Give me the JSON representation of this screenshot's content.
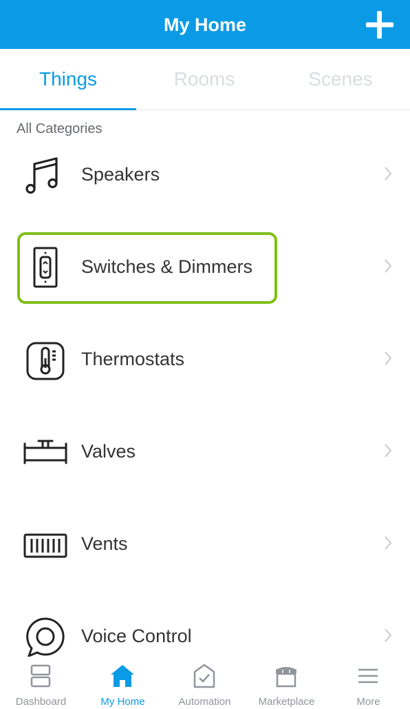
{
  "header": {
    "title": "My Home",
    "add_icon": "plus-icon"
  },
  "tabs": [
    {
      "label": "Things",
      "active": true
    },
    {
      "label": "Rooms",
      "active": false
    },
    {
      "label": "Scenes",
      "active": false
    }
  ],
  "section_label": "All Categories",
  "categories": [
    {
      "label": "Speakers",
      "icon": "music-note-icon"
    },
    {
      "label": "Switches & Dimmers",
      "icon": "light-switch-icon",
      "highlighted": true
    },
    {
      "label": "Thermostats",
      "icon": "thermostat-icon"
    },
    {
      "label": "Valves",
      "icon": "valve-icon"
    },
    {
      "label": "Vents",
      "icon": "vent-icon"
    },
    {
      "label": "Voice Control",
      "icon": "voice-bubble-icon"
    }
  ],
  "bottom_nav": [
    {
      "label": "Dashboard",
      "icon": "dashboard-icon",
      "active": false
    },
    {
      "label": "My Home",
      "icon": "home-icon",
      "active": true
    },
    {
      "label": "Automation",
      "icon": "automation-icon",
      "active": false
    },
    {
      "label": "Marketplace",
      "icon": "marketplace-icon",
      "active": false
    },
    {
      "label": "More",
      "icon": "menu-icon",
      "active": false
    }
  ],
  "colors": {
    "accent": "#0b9be6",
    "highlight_border": "#7fbf1a",
    "inactive_tab": "#d9dde1",
    "nav_inactive": "#8f959b"
  }
}
